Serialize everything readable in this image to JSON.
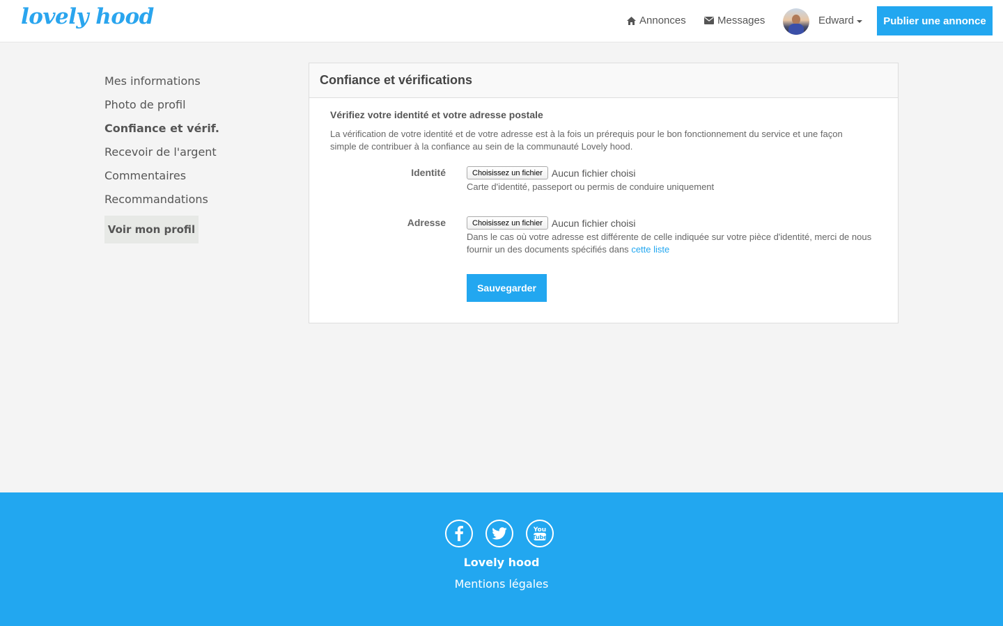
{
  "header": {
    "logo": "lovely hood",
    "nav": {
      "annonces": "Annonces",
      "messages": "Messages"
    },
    "user_name": "Edward",
    "publish_label": "Publier une annonce"
  },
  "sidebar": {
    "items": [
      {
        "label": "Mes informations"
      },
      {
        "label": "Photo de profil"
      },
      {
        "label": "Confiance et vérif."
      },
      {
        "label": "Recevoir de l'argent"
      },
      {
        "label": "Commentaires"
      },
      {
        "label": "Recommandations"
      }
    ],
    "active_index": 2,
    "profile_button": "Voir mon profil"
  },
  "panel": {
    "title": "Confiance et vérifications",
    "section_title": "Vérifiez votre identité et votre adresse postale",
    "section_desc": "La vérification de votre identité et de votre adresse est à la fois un prérequis pour le bon fonctionnement du service et une façon simple de contribuer à la confiance au sein de la communauté Lovely hood.",
    "identity": {
      "label": "Identité",
      "file_button": "Choisissez un fichier",
      "file_status": "Aucun fichier choisi",
      "help": "Carte d'identité, passeport ou permis de conduire uniquement"
    },
    "address": {
      "label": "Adresse",
      "file_button": "Choisissez un fichier",
      "file_status": "Aucun fichier choisi",
      "help": "Dans le cas où votre adresse est différente de celle indiquée sur votre pièce d'identité, merci de nous fournir un des documents spécifiés dans",
      "help_link": "cette liste"
    },
    "save_label": "Sauvegarder"
  },
  "footer": {
    "brand": "Lovely hood",
    "legal": "Mentions légales"
  },
  "colors": {
    "accent": "#22a7f0",
    "background": "#f4f4f4"
  }
}
